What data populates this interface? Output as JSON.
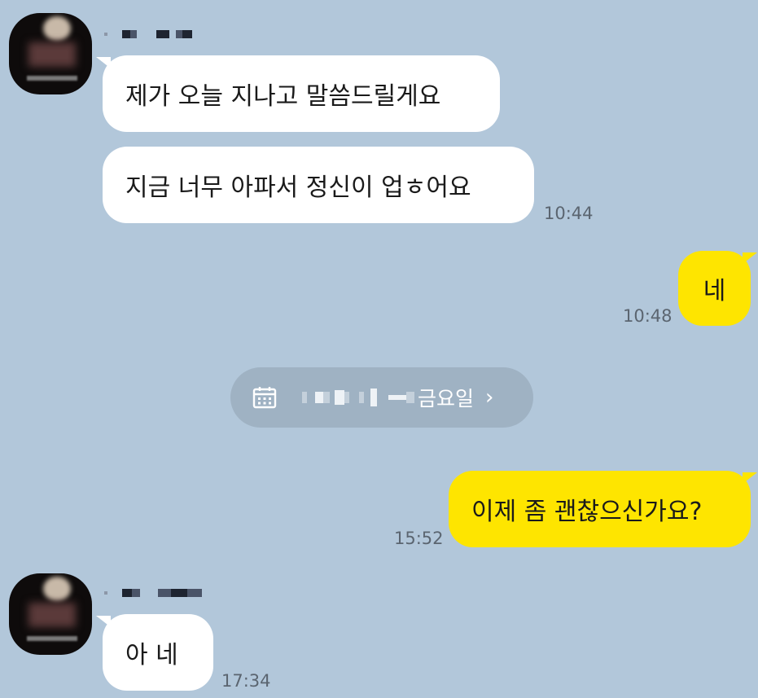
{
  "thread": [
    {
      "side": "in",
      "text": "제가 오늘 지나고 말씀드릴게요"
    },
    {
      "side": "in",
      "text": "지금 너무 아파서 정신이 업ㅎ어요",
      "time": "10:44"
    },
    {
      "side": "out",
      "text": "네",
      "time": "10:48"
    },
    {
      "side": "out",
      "text": "이제 좀 괜찮으신가요?",
      "time": "15:52"
    },
    {
      "side": "in",
      "text": "아 네",
      "time": "17:34"
    }
  ],
  "date_divider": {
    "label": "금요일",
    "chevron": "›",
    "icon": "calendar-icon"
  },
  "colors": {
    "background": "#b2c7da",
    "incoming_bubble": "#ffffff",
    "outgoing_bubble": "#fee500",
    "timestamp": "#5b6570",
    "divider": "#9fb2c3"
  }
}
